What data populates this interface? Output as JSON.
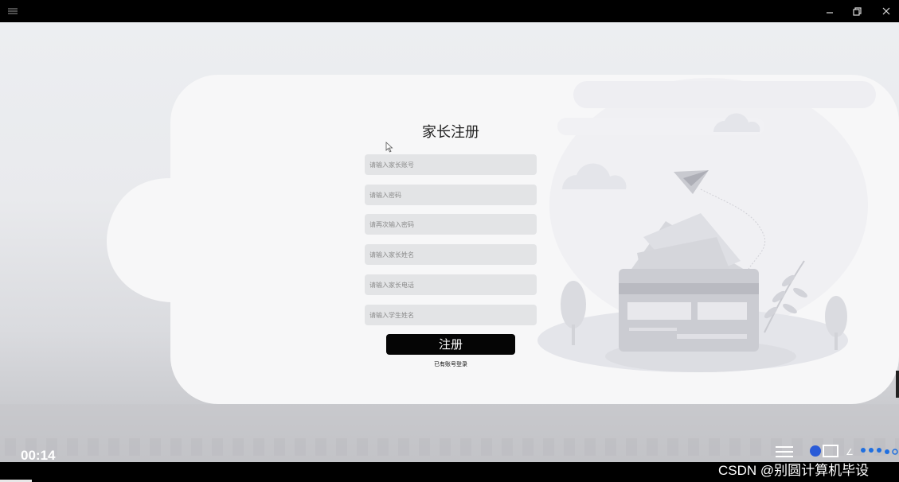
{
  "window": {
    "menu_icon": "hamburger-icon",
    "min_icon": "minimize-icon",
    "restore_icon": "restore-icon",
    "close_icon": "close-icon"
  },
  "form": {
    "title": "家长注册",
    "fields": [
      {
        "name": "parent-account-input",
        "placeholder": "请输入家长账号"
      },
      {
        "name": "password-input",
        "placeholder": "请输入密码"
      },
      {
        "name": "confirm-password-input",
        "placeholder": "请再次输入密码"
      },
      {
        "name": "parent-name-input",
        "placeholder": "请输入家长姓名"
      },
      {
        "name": "parent-phone-input",
        "placeholder": "请输入家长电话"
      },
      {
        "name": "student-name-input",
        "placeholder": "请输入学生姓名"
      }
    ],
    "submit_label": "注册",
    "login_link": "已有账号登录"
  },
  "player": {
    "time": "00:14",
    "progress": 0.035
  },
  "watermark": "CSDN @别圆计算机毕设",
  "colors": {
    "button_bg": "#050505",
    "field_bg": "#e3e4e6",
    "page_bg": "#eceef1"
  }
}
